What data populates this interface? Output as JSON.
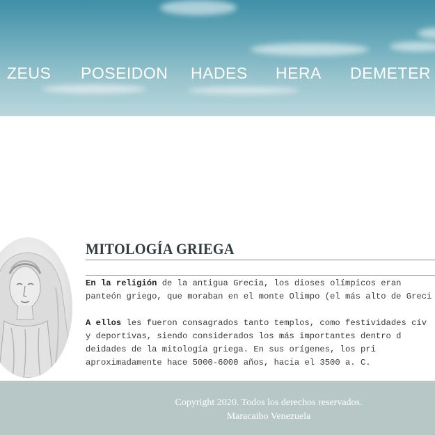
{
  "nav": {
    "items": [
      "ZEUS",
      "POSEIDON",
      "HADES",
      "HERA",
      "DEMETER"
    ]
  },
  "main": {
    "title": "MITOLOGÍA GRIEGA",
    "paragraph1": {
      "lead": "En la religión",
      "line1_rest": " de la antigua Grecia, los dioses olímpicos eran",
      "line2": "panteón griego, que moraban en el monte Olimpo (el más alto de Greci"
    },
    "paragraph2": {
      "lead": "A ellos",
      "line1_rest": " les fueron consagrados tanto templos, como festividades cív",
      "line2": "y deportivas, siendo considerados los más importantes dentro d",
      "line3": "deidades de la mitología griega. En sus orígenes, los pri",
      "line4": "aproximadamente hace 5000-6000 años, hacia el 3500 a. C."
    }
  },
  "footer": {
    "copyright": "Copyright 2020. Todos los derechos reservados.",
    "location": "Maracaibo Venezuela"
  },
  "colors": {
    "header_sky": "#6aabbb",
    "footer_bg": "#b7c7c5",
    "title_text": "#2f3b40"
  }
}
